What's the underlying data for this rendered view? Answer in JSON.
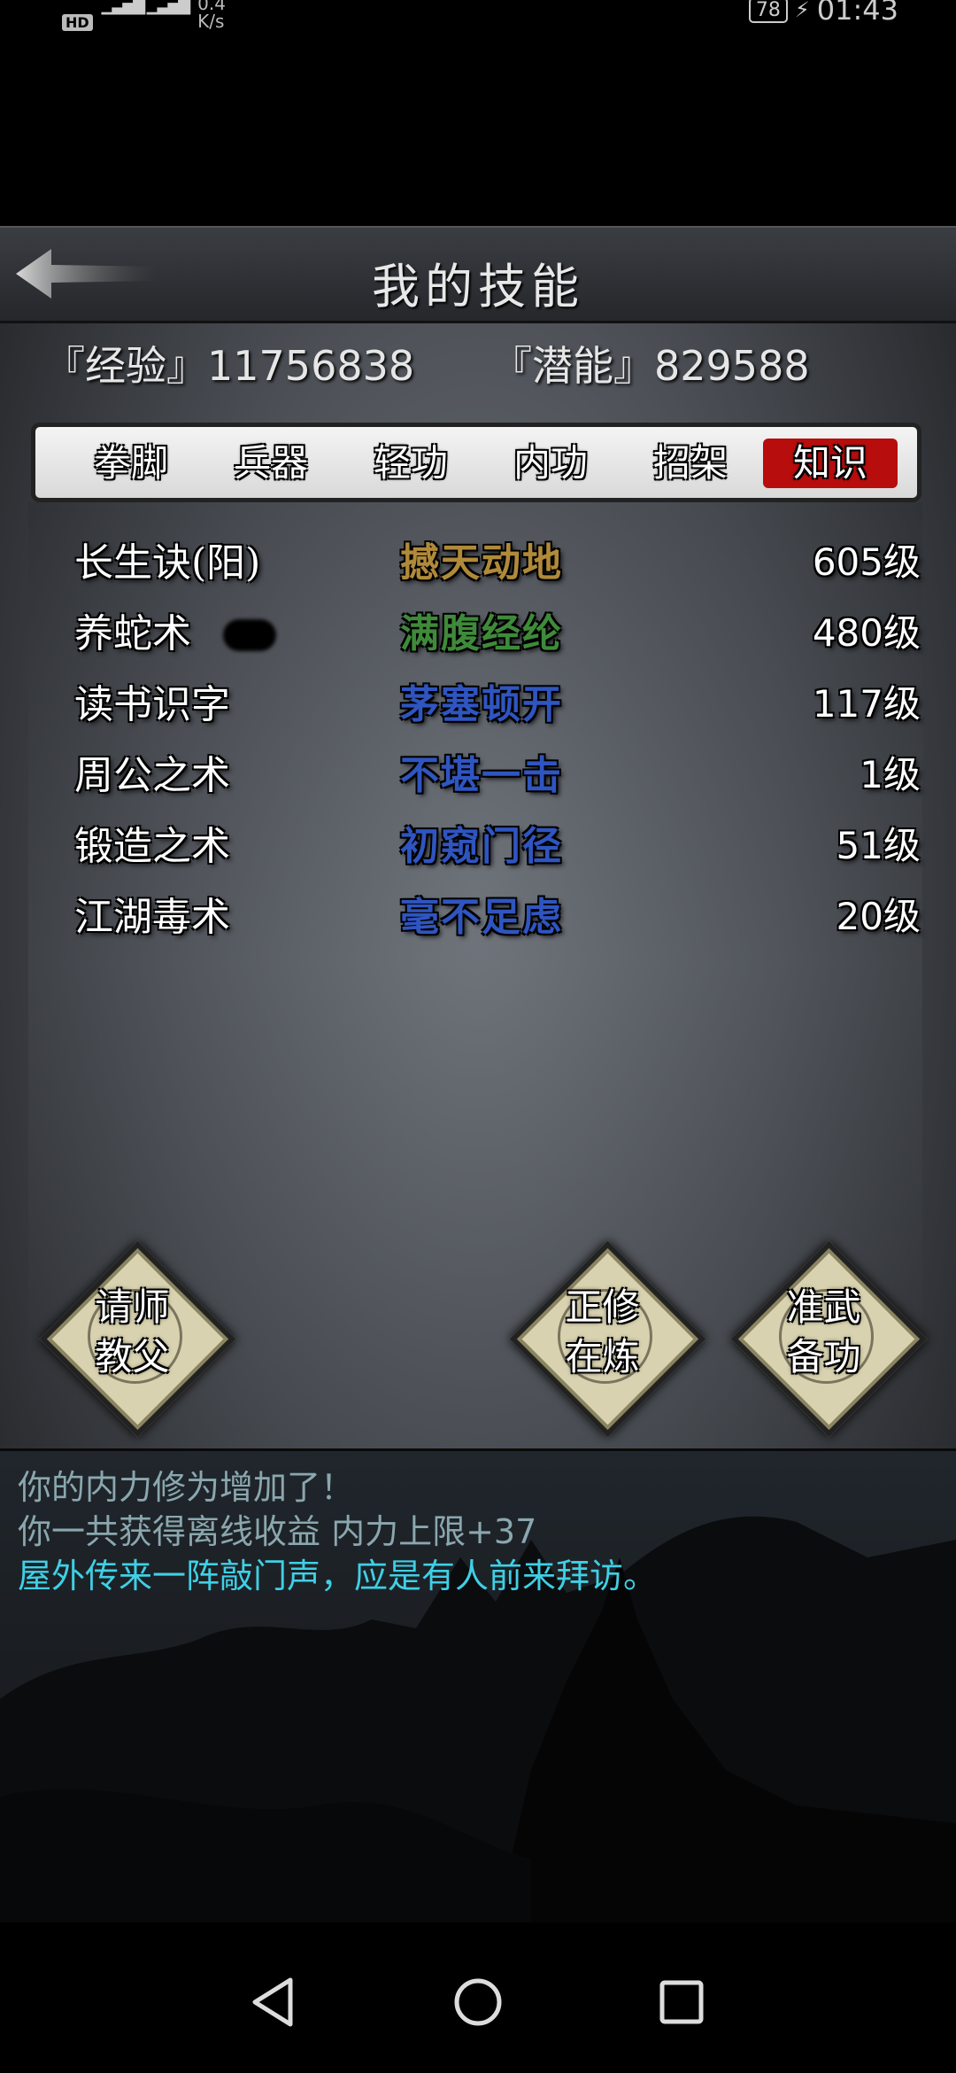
{
  "status_bar": {
    "hd": "HD",
    "net_speed": "0.4",
    "net_unit": "K/s",
    "battery": "78",
    "time": "01:43"
  },
  "header": {
    "title": "我的技能"
  },
  "stats": {
    "experience": "『经验』11756838",
    "potential": "『潜能』829588"
  },
  "tabs": [
    {
      "label": "拳脚"
    },
    {
      "label": "兵器"
    },
    {
      "label": "轻功"
    },
    {
      "label": "内功"
    },
    {
      "label": "招架"
    },
    {
      "label": "知识",
      "active": true
    }
  ],
  "skills": [
    {
      "name": "长生诀(阳)",
      "grade": "撼天动地",
      "grade_color": "#b08a3a",
      "level": "605级"
    },
    {
      "name": "养蛇术",
      "grade": "满腹经纶",
      "grade_color": "#3f8a3a",
      "level": "480级"
    },
    {
      "name": "读书识字",
      "grade": "茅塞顿开",
      "grade_color": "#2f55c0",
      "level": "117级"
    },
    {
      "name": "周公之术",
      "grade": "不堪一击",
      "grade_color": "#2f55c0",
      "level": "1级"
    },
    {
      "name": "锻造之术",
      "grade": "初窥门径",
      "grade_color": "#2f55c0",
      "level": "51级"
    },
    {
      "name": "江湖毒术",
      "grade": "毫不足虑",
      "grade_color": "#2f55c0",
      "level": "20级"
    }
  ],
  "actions": {
    "teacher": {
      "line1": "请师",
      "line2": "教父"
    },
    "training": {
      "line1": "正修",
      "line2": "在炼"
    },
    "prepare": {
      "line1": "准武",
      "line2": "备功"
    }
  },
  "log": [
    {
      "text": "你的内力修为增加了！",
      "color": "#8aa7ae"
    },
    {
      "text": "你一共获得离线收益 内力上限+37",
      "color": "#8aa7ae"
    },
    {
      "text": "屋外传来一阵敲门声，应是有人前来拜访。",
      "color": "#3fd0e6"
    }
  ],
  "icons": {
    "back": "back-arrow-icon",
    "nav_back": "triangle-back-icon",
    "nav_home": "circle-home-icon",
    "nav_recent": "square-recent-icon"
  }
}
